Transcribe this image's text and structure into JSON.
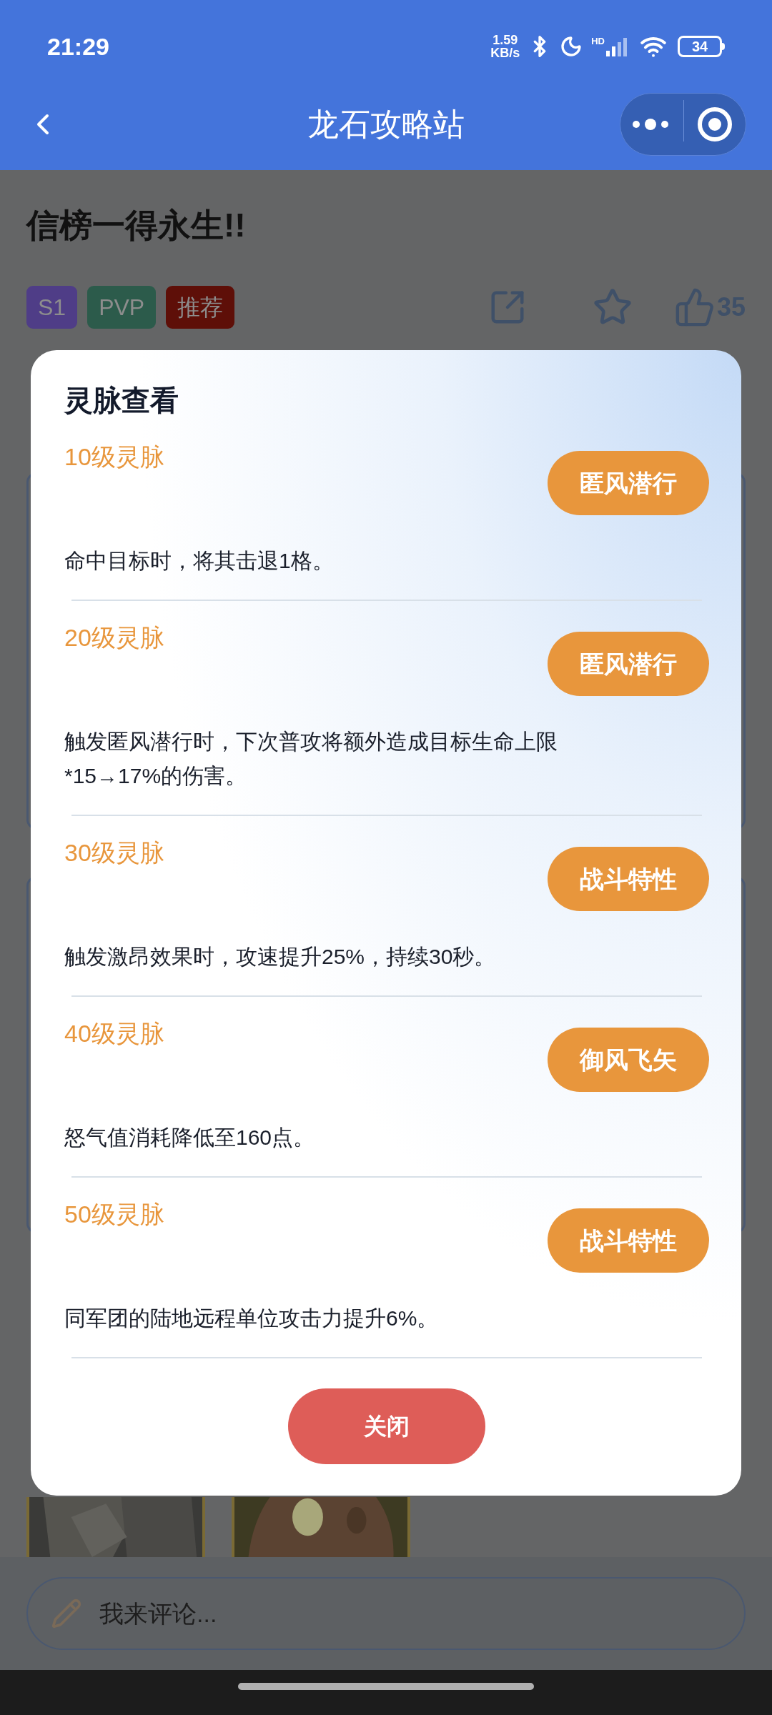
{
  "status_bar": {
    "time": "21:29",
    "net_speed": "1.59",
    "net_unit": "KB/s",
    "signal_label": "HD",
    "battery": "34"
  },
  "nav": {
    "title": "龙石攻略站"
  },
  "post": {
    "title": "信榜一得永生!!",
    "likes": "35",
    "tags": [
      {
        "label": "S1",
        "color": "#4f3d87"
      },
      {
        "label": "PVP",
        "color": "#2c5b4b"
      },
      {
        "label": "推荐",
        "color": "#5e0f08"
      }
    ]
  },
  "comment": {
    "placeholder": "我来评论..."
  },
  "dialog": {
    "title": "灵脉查看",
    "close": "关闭",
    "rows": [
      {
        "tier": "10级灵脉",
        "skill": "匿风潜行",
        "description": "命中目标时，将其击退1格。"
      },
      {
        "tier": "20级灵脉",
        "skill": "匿风潜行",
        "description": "触发匿风潜行时，下次普攻将额外造成目标生命上限*15→17%的伤害。"
      },
      {
        "tier": "30级灵脉",
        "skill": "战斗特性",
        "description": "触发激昂效果时，攻速提升25%，持续30秒。"
      },
      {
        "tier": "40级灵脉",
        "skill": "御风飞矢",
        "description": "怒气值消耗降低至160点。"
      },
      {
        "tier": "50级灵脉",
        "skill": "战斗特性",
        "description": "同军团的陆地远程单位攻击力提升6%。"
      }
    ]
  }
}
